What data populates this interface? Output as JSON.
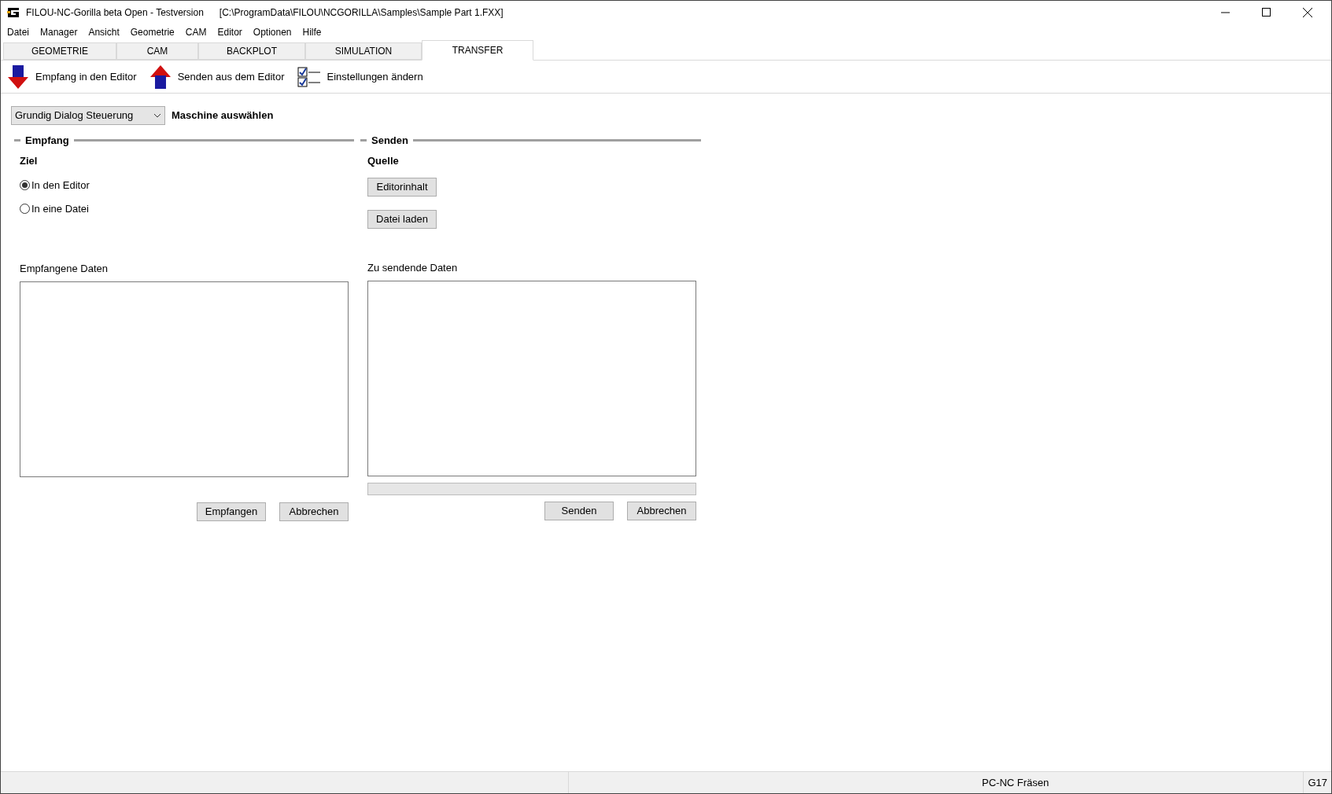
{
  "window": {
    "title": "FILOU-NC-Gorilla beta Open - Testversion",
    "path": "[C:\\ProgramData\\FILOU\\NCGORILLA\\Samples\\Sample Part 1.FXX]"
  },
  "menu": [
    "Datei",
    "Manager",
    "Ansicht",
    "Geometrie",
    "CAM",
    "Editor",
    "Optionen",
    "Hilfe"
  ],
  "tabs": [
    {
      "label": "GEOMETRIE",
      "selected": false
    },
    {
      "label": "CAM",
      "selected": false
    },
    {
      "label": "BACKPLOT",
      "selected": false
    },
    {
      "label": "SIMULATION",
      "selected": false
    },
    {
      "label": "TRANSFER",
      "selected": true
    }
  ],
  "toolbar": [
    {
      "kind": "receive",
      "label": "Empfang in den Editor"
    },
    {
      "kind": "send",
      "label": "Senden aus dem Editor"
    },
    {
      "kind": "settings",
      "label": "Einstellungen ändern"
    }
  ],
  "machine": {
    "value": "Grundig Dialog Steuerung",
    "label": "Maschine auswählen"
  },
  "receive": {
    "title": "Empfang",
    "subtitle": "Ziel",
    "options": [
      {
        "label": "In den Editor",
        "selected": true
      },
      {
        "label": "In eine Datei",
        "selected": false
      }
    ],
    "data_label": "Empfangene Daten",
    "buttons": [
      "Empfangen",
      "Abbrechen"
    ]
  },
  "send": {
    "title": "Senden",
    "subtitle": "Quelle",
    "source_buttons": [
      "Editorinhalt",
      "Datei laden"
    ],
    "data_label": "Zu sendende Daten",
    "progress": {
      "level": 0
    },
    "buttons": [
      "Senden",
      "Abbrechen"
    ]
  },
  "status_bar": [
    "PC-NC Fräsen",
    "G17"
  ]
}
